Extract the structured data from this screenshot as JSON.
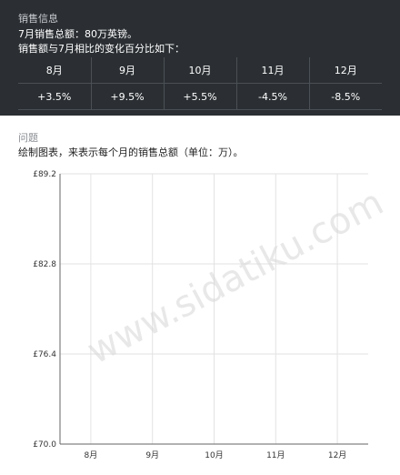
{
  "info": {
    "title": "销售信息",
    "line1": "7月销售总额：80万英镑。",
    "line2": "销售额与7月相比的变化百分比如下：",
    "months": [
      "8月",
      "9月",
      "10月",
      "11月",
      "12月"
    ],
    "changes": [
      "+3.5%",
      "+9.5%",
      "+5.5%",
      "-4.5%",
      "-8.5%"
    ]
  },
  "question": {
    "label": "问题",
    "text": "绘制图表，来表示每个月的销售总额（单位：万）。"
  },
  "watermark": "www.sidatiku.com",
  "chart_data": {
    "type": "line",
    "categories": [
      "8月",
      "9月",
      "10月",
      "11月",
      "12月"
    ],
    "series": [],
    "ylim": [
      70.0,
      89.2
    ],
    "yticks": [
      "£89.2",
      "£82.8",
      "£76.4",
      "£70.0"
    ],
    "ytick_values": [
      89.2,
      82.8,
      76.4,
      70.0
    ],
    "grid": true
  }
}
